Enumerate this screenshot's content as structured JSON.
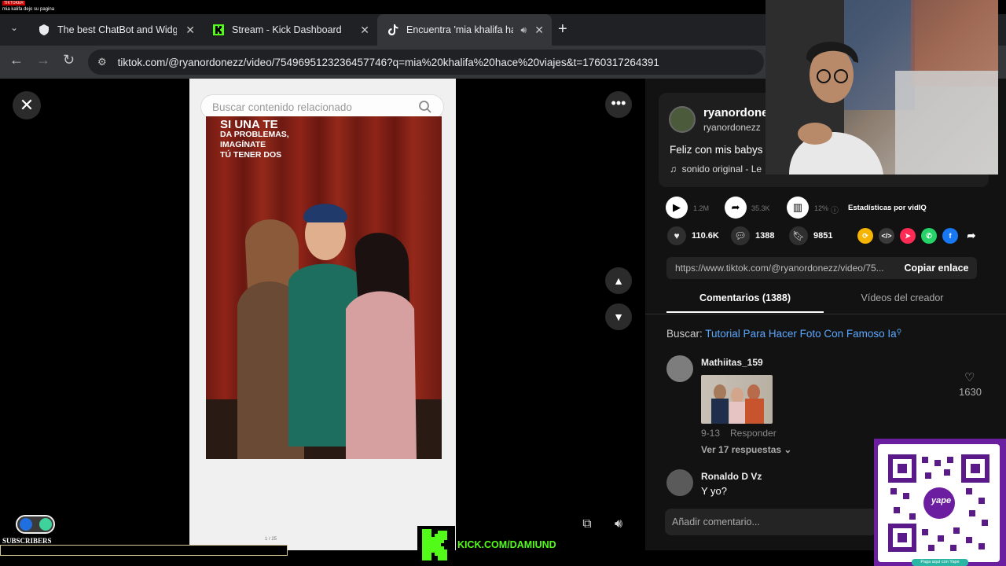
{
  "overlay_top": {
    "badge": "TIKTOKER",
    "note": "mia kalifa dejo su pagina"
  },
  "tabs": [
    {
      "title": "The best ChatBot and Widgets",
      "icon": "shield-icon"
    },
    {
      "title": "Stream - Kick Dashboard",
      "icon": "kick-icon"
    },
    {
      "title": "Encuentra 'mia khalifa hace",
      "icon": "tiktok-icon",
      "audio": "speaker-icon"
    }
  ],
  "address_bar": {
    "url": "tiktok.com/@ryanordonezz/video/7549695123236457746?q=mia%20khalifa%20hace%20viajes&t=1760317264391"
  },
  "player": {
    "search_placeholder": "Buscar contenido relacionado",
    "caption_overlay": [
      "SI UNA TE",
      "DA PROBLEMAS,",
      "IMAGÍNATE",
      "TÚ TENER DOS"
    ],
    "counter": "1 / 25"
  },
  "author": {
    "name": "ryanordone",
    "handle": "ryanordonezz",
    "caption": "Feliz con mis babys",
    "sound": "sonido original - Le"
  },
  "stats": {
    "plays": "1.2M",
    "shares": "35.3K",
    "engagement": "12%",
    "stats_label": "Estadísticas por vidIQ"
  },
  "actions": {
    "likes": "110.6K",
    "comments": "1388",
    "saves": "9851"
  },
  "share_colors": {
    "repost": "#f5b400",
    "embed": "#3a3a3a",
    "send": "#fe2c55",
    "whatsapp": "#25d366",
    "facebook": "#1877f2"
  },
  "link": {
    "url": "https://www.tiktok.com/@ryanordonezz/video/75...",
    "copy_label": "Copiar enlace"
  },
  "panel_tabs": {
    "comments": "Comentarios (1388)",
    "creator_videos": "Vídeos del creador"
  },
  "related_search": {
    "prefix": "Buscar:",
    "query": "Tutorial Para Hacer Foto Con Famoso Ia"
  },
  "comments": [
    {
      "user": "Mathiitas_159",
      "date": "9-13",
      "reply_label": "Responder",
      "replies": "Ver 17 respuestas",
      "likes": "1630"
    },
    {
      "user": "Ronaldo D Vz",
      "text": "Y yo?"
    }
  ],
  "add_comment_placeholder": "Añadir comentario...",
  "kick": {
    "url": "KICK.COM/DAMIUND"
  },
  "subs": {
    "label": "SUBSCRIBERS"
  },
  "qr": {
    "brand": "yape",
    "caption": "Paga aquí con Yape"
  }
}
